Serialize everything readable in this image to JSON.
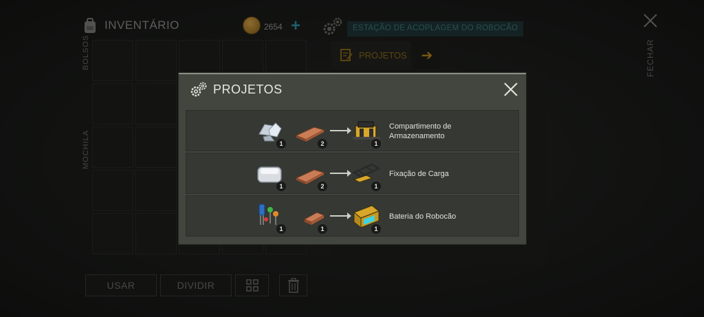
{
  "inventory": {
    "title": "INVENTÁRIO",
    "pockets_label": "BOLSOS",
    "backpack_label": "MOCHILA",
    "coins": "2654",
    "buttons": {
      "use": "USAR",
      "split": "DIVIDIR"
    }
  },
  "station": {
    "title": "ESTAÇÃO DE ACOPLAGEM DO ROBOCÃO",
    "tab_label": "PROJETOS",
    "close_label": "FECHAR"
  },
  "modal": {
    "title": "PROJETOS",
    "recipes": [
      {
        "name": "Compartimento de Armazenamento",
        "ingredients": [
          {
            "icon": "ore-chunk-icon",
            "qty": "1"
          },
          {
            "icon": "copper-ingot-icon",
            "qty": "2"
          }
        ],
        "result": {
          "icon": "storage-compartment-icon",
          "qty": "1"
        }
      },
      {
        "name": "Fixação de Carga",
        "ingredients": [
          {
            "icon": "metal-bar-icon",
            "qty": "1"
          },
          {
            "icon": "copper-ingot-icon",
            "qty": "2"
          }
        ],
        "result": {
          "icon": "cargo-mount-icon",
          "qty": "1"
        }
      },
      {
        "name": "Bateria do Robocão",
        "ingredients": [
          {
            "icon": "electronic-components-icon",
            "qty": "1"
          },
          {
            "icon": "copper-piece-icon",
            "qty": "1"
          }
        ],
        "result": {
          "icon": "robodog-battery-icon",
          "qty": "1"
        }
      }
    ]
  },
  "colors": {
    "accent": "#b88a1e",
    "teal": "#2f8fa6",
    "modal_bg": "#43463f"
  }
}
